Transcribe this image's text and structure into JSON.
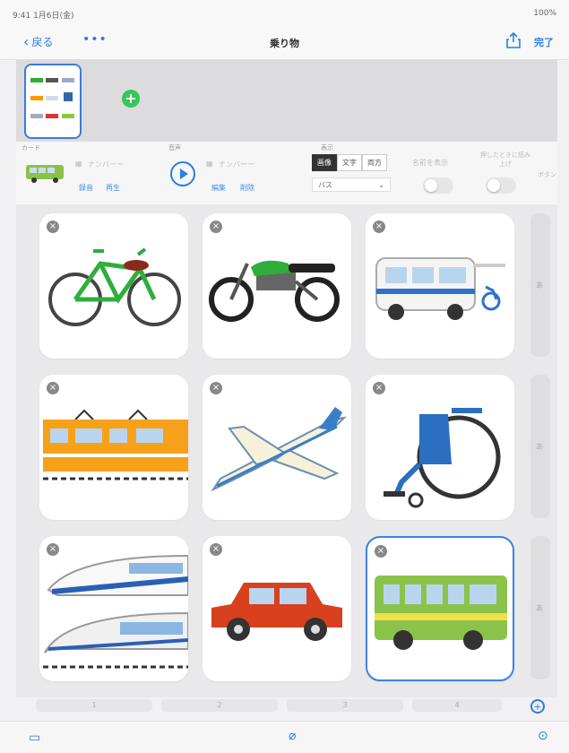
{
  "status_bar": {
    "left": "9:41 1月6日(金)",
    "right": "100%"
  },
  "nav": {
    "back_label": "戻る",
    "more_label": "•••",
    "title": "乗り物",
    "done_label": "完了"
  },
  "controls": {
    "label_card": "カード",
    "label_voice": "音声",
    "label_display": "表示",
    "audio_text_1": "ナンバーー",
    "audio_text_2": "ナンバーー",
    "record_label": "録音",
    "play_label": "再生",
    "edit_label": "編集",
    "delete_label": "削除",
    "segments": [
      "画像",
      "文字",
      "両方"
    ],
    "select_value": "バス",
    "toggle_1_label": "名前を表示",
    "toggle_2_label": "押したときに読み上げ",
    "more_label": "ボタン"
  },
  "cards": [
    {
      "name": "bicycle",
      "image": "bicycle-image"
    },
    {
      "name": "motorcycle",
      "image": "motorcycle-image"
    },
    {
      "name": "welfare-van",
      "image": "welfare-van-image"
    },
    {
      "name": "train",
      "image": "train-image"
    },
    {
      "name": "airplane",
      "image": "airplane-image"
    },
    {
      "name": "wheelchair",
      "image": "wheelchair-image"
    },
    {
      "name": "shinkansen",
      "image": "shinkansen-image"
    },
    {
      "name": "car",
      "image": "car-image"
    },
    {
      "name": "bus",
      "image": "bus-image",
      "selected": true
    }
  ],
  "side_labels": [
    "あ",
    "あ",
    "あ"
  ],
  "pager": [
    "1",
    "2",
    "3",
    "4"
  ],
  "colors": {
    "accent": "#2a7de1",
    "selected_border": "#3a82e6",
    "add_green": "#34c759"
  }
}
